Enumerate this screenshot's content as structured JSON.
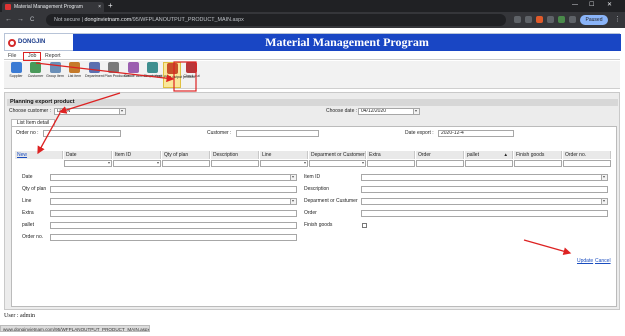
{
  "browser": {
    "tab_title": "Material Management Program",
    "tab_close": "×",
    "new_tab": "+",
    "win_min": "—",
    "win_max": "☐",
    "win_close": "✕",
    "back": "←",
    "forward": "→",
    "reload": "C",
    "security": "Not secure",
    "url_host": "donginvietnam.com",
    "url_path": "/95/WFPLANOUTPUT_PRODUCT_MAIN.aspx",
    "profile_status": "Paused",
    "menu": "⋮"
  },
  "header": {
    "logo_text": "DONGJIN",
    "app_title": "Material Management Program"
  },
  "menu": {
    "items": [
      {
        "label": "File"
      },
      {
        "label": "Job"
      },
      {
        "label": "Report"
      }
    ]
  },
  "toolbar": {
    "buttons": [
      {
        "label": "Supplier",
        "color": "#3b7bd4"
      },
      {
        "label": "Customer",
        "color": "#4a9a5a"
      },
      {
        "label": "Group item",
        "color": "#6a8fb8"
      },
      {
        "label": "List item",
        "color": "#c57a2a"
      },
      {
        "label": "Department",
        "color": "#5b6fb0"
      },
      {
        "label": "Plan Production",
        "color": "#7a7a7a"
      },
      {
        "label": "Create label for product",
        "color": "#9b5fb0"
      },
      {
        "label": "Check input",
        "color": "#3f8f8f"
      },
      {
        "label": "Plan output product",
        "color": "#c8502a"
      },
      {
        "label": "Check out",
        "color": "#b8363a"
      }
    ]
  },
  "form": {
    "section_title": "Planning export product",
    "choose_customer_label": "Choose customer :",
    "choose_customer_value": "DJVN",
    "choose_date_label": "Choose date :",
    "choose_date_value": "04/12/2020",
    "detail_tab": "List Item detail",
    "order_no_label": "Order no :",
    "order_no_value": "",
    "customer_label": "Customer :",
    "customer_value": "",
    "date_export_label": "Date export :",
    "date_export_value": "2020-12-4"
  },
  "grid": {
    "new_link": "New",
    "sort_icon": "▲",
    "columns": [
      {
        "label": "Date"
      },
      {
        "label": "Item ID"
      },
      {
        "label": "Qty of plan"
      },
      {
        "label": "Description"
      },
      {
        "label": "Line"
      },
      {
        "label": "Deparment or Customer"
      },
      {
        "label": "Extra"
      },
      {
        "label": "Order"
      },
      {
        "label": "pallet"
      },
      {
        "label": "Finish goods"
      },
      {
        "label": "Order no."
      }
    ]
  },
  "edit": {
    "left": [
      {
        "label": "Date"
      },
      {
        "label": "Qty of plan"
      },
      {
        "label": "Line"
      },
      {
        "label": "Extra"
      },
      {
        "label": "pallet"
      },
      {
        "label": "Order no."
      }
    ],
    "right": [
      {
        "label": "Item ID"
      },
      {
        "label": "Description"
      },
      {
        "label": "Deparment or Custumer"
      },
      {
        "label": "Order"
      },
      {
        "label": "Finish goods"
      }
    ],
    "update_link": "Update",
    "cancel_link": "Cancel"
  },
  "footer": {
    "user_line": "User : admin",
    "status_url": "www.donginvietnam.com/95/WFPLANOUTPUT_PRODUCT_MAIN.aspx"
  },
  "colors": {
    "banner": "#1946c4",
    "annotation": "#dd2222",
    "link": "#1a4dbf"
  }
}
